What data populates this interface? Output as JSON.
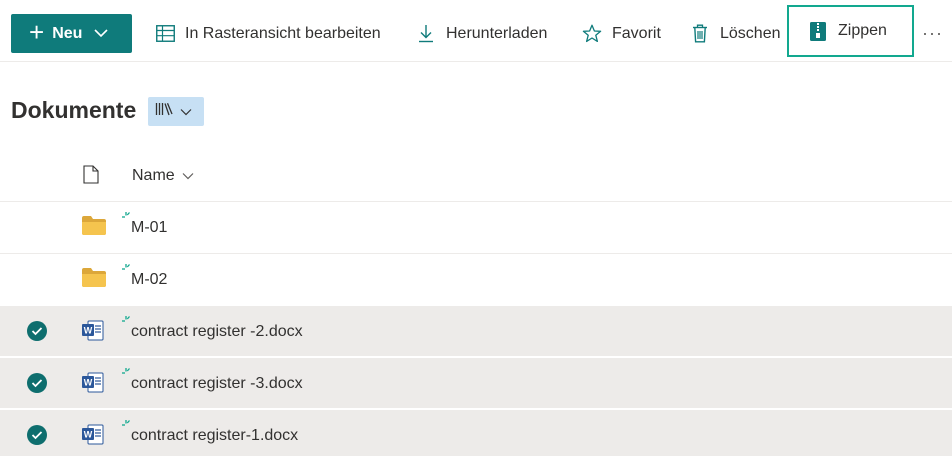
{
  "toolbar": {
    "new_label": "Neu",
    "grid_edit_label": "In Rasteransicht bearbeiten",
    "download_label": "Herunterladen",
    "favorite_label": "Favorit",
    "delete_label": "Löschen",
    "zip_label": "Zippen",
    "more_label": "···"
  },
  "library": {
    "title": "Dokumente",
    "view_icon": "library-icon"
  },
  "list": {
    "column_name": "Name",
    "rows": [
      {
        "name": "M-01",
        "type": "folder",
        "selected": false
      },
      {
        "name": "M-02",
        "type": "folder",
        "selected": false
      },
      {
        "name": "contract register -2.docx",
        "type": "word",
        "selected": true
      },
      {
        "name": "contract register -3.docx",
        "type": "word",
        "selected": true
      },
      {
        "name": "contract register-1.docx",
        "type": "word",
        "selected": true
      }
    ]
  },
  "colors": {
    "accent": "#0f7b7b",
    "zip_highlight": "#12a88f",
    "selected_row": "#edebe9",
    "folder": "#f5c44e",
    "word": "#2b579a"
  }
}
